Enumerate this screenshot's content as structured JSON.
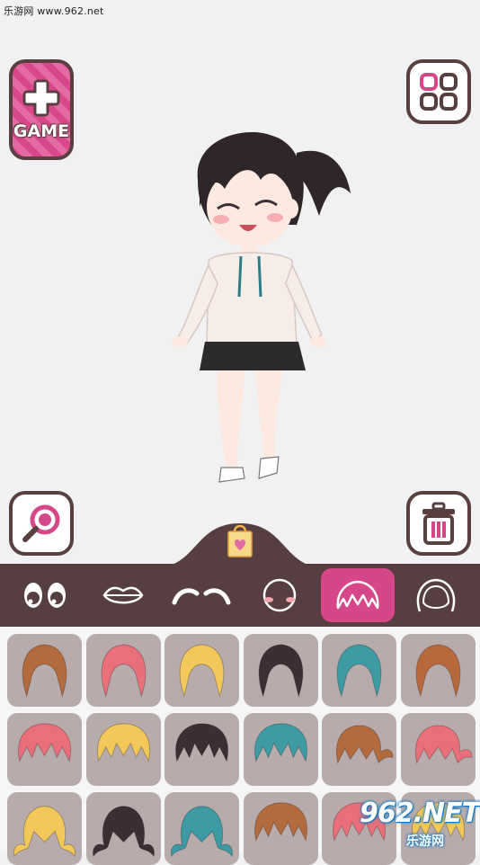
{
  "watermark": {
    "top_text": "乐游网 www.962.net",
    "logo_big": "962.NET",
    "logo_small": "乐游网"
  },
  "buttons": {
    "game_label": "GAME",
    "game_icon": "plus-icon",
    "menu_icon": "grid-icon",
    "zoom_icon": "magnifier-icon",
    "delete_icon": "trash-icon",
    "shop_icon": "shopping-bag-icon"
  },
  "tabs": [
    {
      "name": "eyes",
      "icon": "eyes-icon",
      "active": false
    },
    {
      "name": "mouth",
      "icon": "lips-icon",
      "active": false
    },
    {
      "name": "eyebrows",
      "icon": "eyebrows-icon",
      "active": false
    },
    {
      "name": "face",
      "icon": "face-icon",
      "active": false
    },
    {
      "name": "front-hair",
      "icon": "front-hair-icon",
      "active": true
    },
    {
      "name": "back-hair",
      "icon": "back-hair-icon",
      "active": false
    }
  ],
  "hair_options": [
    {
      "color": "#b36a3d",
      "style": "long"
    },
    {
      "color": "#e9707a",
      "style": "long"
    },
    {
      "color": "#f2c85a",
      "style": "long"
    },
    {
      "color": "#3b2f33",
      "style": "long"
    },
    {
      "color": "#3e9aa3",
      "style": "long"
    },
    {
      "color": "#b8693c",
      "style": "long"
    },
    {
      "color": "#e9707a",
      "style": "short"
    },
    {
      "color": "#f2c85a",
      "style": "short"
    },
    {
      "color": "#3b2f33",
      "style": "short"
    },
    {
      "color": "#3e9aa3",
      "style": "short"
    },
    {
      "color": "#b36a3d",
      "style": "tail"
    },
    {
      "color": "#e9707a",
      "style": "tail"
    },
    {
      "color": "#f2c85a",
      "style": "twin"
    },
    {
      "color": "#3b2f33",
      "style": "twin"
    },
    {
      "color": "#3e9aa3",
      "style": "twin"
    },
    {
      "color": "#b36a3d",
      "style": "short"
    },
    {
      "color": "#e9707a",
      "style": "short"
    },
    {
      "color": "#f2c85a",
      "style": "short"
    }
  ],
  "colors": {
    "accent": "#d6478a",
    "frame": "#573e40",
    "cell_bg": "#b8abab"
  }
}
